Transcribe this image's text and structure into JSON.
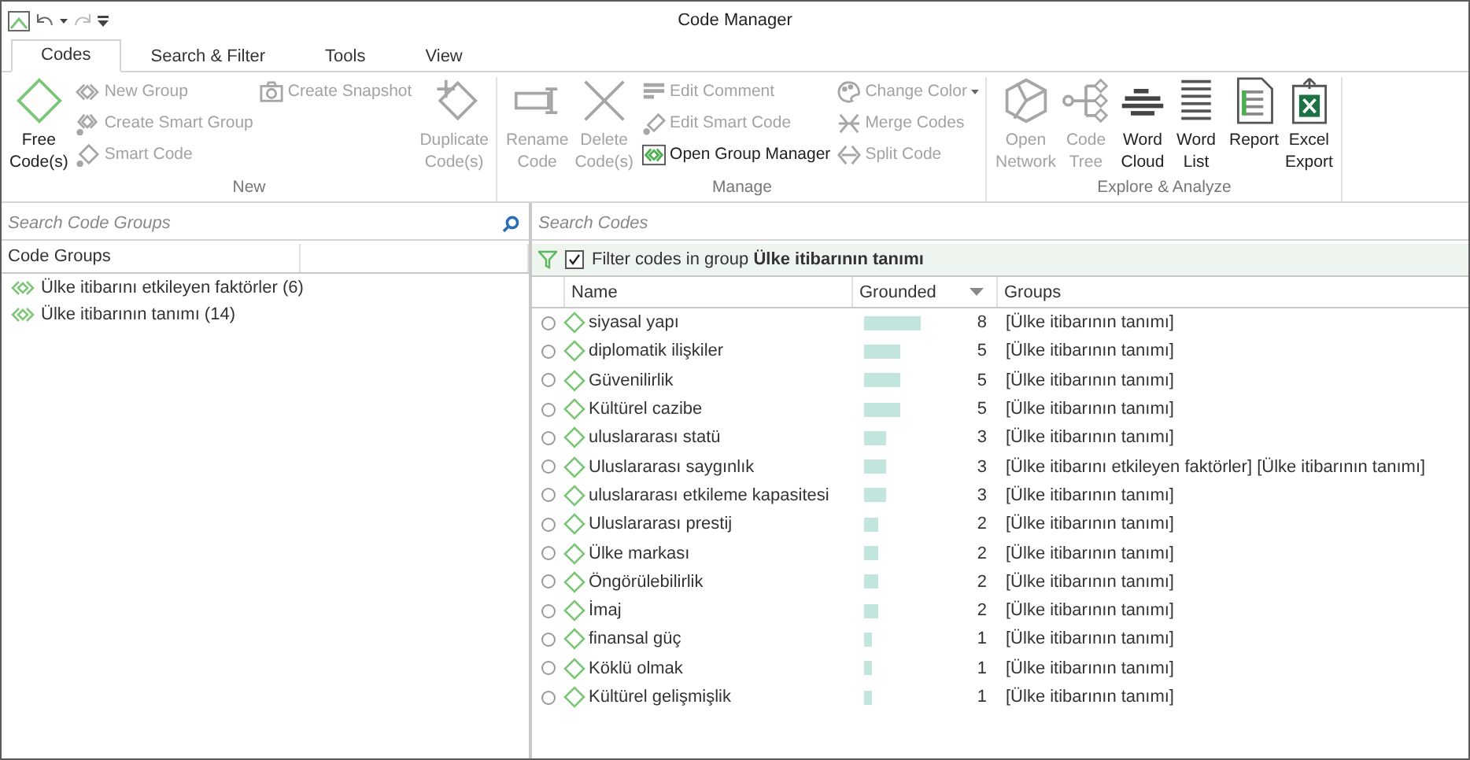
{
  "window": {
    "title": "Code Manager"
  },
  "tabs": [
    {
      "label": "Codes",
      "selected": true
    },
    {
      "label": "Search & Filter",
      "selected": false
    },
    {
      "label": "Tools",
      "selected": false
    },
    {
      "label": "View",
      "selected": false
    }
  ],
  "ribbon": [
    {
      "name": "New",
      "columns": [
        {
          "kind": "large",
          "items": [
            {
              "label": "Free Code(s)",
              "disabled": false
            }
          ]
        },
        {
          "kind": "stack",
          "items": [
            {
              "label": "New Group",
              "disabled": true,
              "menu": false
            },
            {
              "label": "Create Smart Group",
              "disabled": true,
              "menu": false
            },
            {
              "label": "Smart Code",
              "disabled": true,
              "menu": false
            }
          ]
        },
        {
          "kind": "stack",
          "items": [
            {
              "label": "Create Snapshot",
              "disabled": true,
              "menu": false
            }
          ]
        },
        {
          "kind": "large",
          "items": [
            {
              "label": "Duplicate Code(s)",
              "disabled": true
            }
          ]
        }
      ]
    },
    {
      "name": "Manage",
      "columns": [
        {
          "kind": "large",
          "items": [
            {
              "label": "Rename Code",
              "disabled": true
            },
            {
              "label": "Delete Code(s)",
              "disabled": true
            }
          ]
        },
        {
          "kind": "stack",
          "items": [
            {
              "label": "Edit Comment",
              "disabled": true,
              "menu": false
            },
            {
              "label": "Edit Smart Code",
              "disabled": true,
              "menu": false
            },
            {
              "label": "Open Group Manager",
              "disabled": false,
              "menu": false
            }
          ]
        },
        {
          "kind": "stack",
          "items": [
            {
              "label": "Change Color",
              "disabled": true,
              "menu": true
            },
            {
              "label": "Merge Codes",
              "disabled": true,
              "menu": false
            },
            {
              "label": "Split Code",
              "disabled": true,
              "menu": false
            }
          ]
        }
      ]
    },
    {
      "name": "Explore & Analyze",
      "columns": [
        {
          "kind": "large",
          "items": [
            {
              "label": "Open Network",
              "disabled": true
            },
            {
              "label": "Code Tree",
              "disabled": true
            }
          ]
        },
        {
          "kind": "large",
          "items": [
            {
              "label": "Word Cloud",
              "disabled": false
            },
            {
              "label": "Word List",
              "disabled": false
            }
          ]
        },
        {
          "kind": "large",
          "items": [
            {
              "label": "Report",
              "disabled": false
            },
            {
              "label": "Excel Export",
              "disabled": false
            }
          ]
        }
      ]
    }
  ],
  "groups_pane": {
    "search": {
      "placeholder": "Search Code Groups"
    },
    "header": "Code Groups",
    "items": [
      {
        "label": "Ülke itibarını etkileyen faktörler (6)"
      },
      {
        "label": "Ülke itibarının tanımı (14)"
      }
    ]
  },
  "codes_pane": {
    "search": {
      "placeholder": "Search Codes"
    },
    "filter": {
      "checked": true,
      "text": "Filter codes in group **Ülke itibarının tanımı**"
    },
    "columns": [
      {
        "label": "Name",
        "sorted": false
      },
      {
        "label": "Grounded",
        "sorted": true
      },
      {
        "label": "Groups",
        "sorted": false
      }
    ],
    "rows": [
      {
        "name": "siyasal yapı",
        "grounded": "8",
        "groups": "[Ülke itibarının tanımı]"
      },
      {
        "name": "diplomatik ilişkiler",
        "grounded": "5",
        "groups": "[Ülke itibarının tanımı]"
      },
      {
        "name": "Güvenilirlik",
        "grounded": "5",
        "groups": "[Ülke itibarının tanımı]"
      },
      {
        "name": "Kültürel cazibe",
        "grounded": "5",
        "groups": "[Ülke itibarının tanımı]"
      },
      {
        "name": "uluslararası statü",
        "grounded": "3",
        "groups": "[Ülke itibarının tanımı]"
      },
      {
        "name": "Uluslararası saygınlık",
        "grounded": "3",
        "groups": "[Ülke itibarını etkileyen faktörler] [Ülke itibarının tanımı]"
      },
      {
        "name": "uluslararası etkileme kapasitesi",
        "grounded": "3",
        "groups": "[Ülke itibarının tanımı]"
      },
      {
        "name": "Uluslararası prestij",
        "grounded": "2",
        "groups": "[Ülke itibarının tanımı]"
      },
      {
        "name": "Ülke markası",
        "grounded": "2",
        "groups": "[Ülke itibarının tanımı]"
      },
      {
        "name": "Öngörülebilirlik",
        "grounded": "2",
        "groups": "[Ülke itibarının tanımı]"
      },
      {
        "name": "İmaj",
        "grounded": "2",
        "groups": "[Ülke itibarının tanımı]"
      },
      {
        "name": "finansal güç",
        "grounded": "1",
        "groups": "[Ülke itibarının tanımı]"
      },
      {
        "name": "Köklü olmak",
        "grounded": "1",
        "groups": "[Ülke itibarının tanımı]"
      },
      {
        "name": "Kültürel gelişmişlik",
        "grounded": "1",
        "groups": "[Ülke itibarının tanımı]"
      }
    ]
  }
}
